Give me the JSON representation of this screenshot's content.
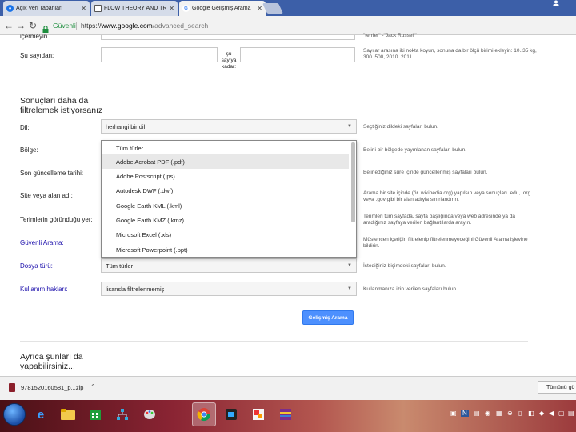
{
  "browser": {
    "tabs": [
      {
        "title": "Açık Veri Tabanları",
        "favicon": "#1a73e8",
        "active": false
      },
      {
        "title": "FLOW THEORY AND TRA",
        "favicon": "#7a5",
        "active": false
      },
      {
        "title": "Google Gelişmiş Arama",
        "favicon": "#fff",
        "favicon_letter": "G",
        "active": true
      }
    ],
    "secure_label": "Güvenli",
    "url_scheme": "https://",
    "url_host": "www.google.com",
    "url_path": "/advanced_search"
  },
  "form": {
    "top_cut_label": "içermeyin",
    "top_cut_hint": "\"terrier\" -\"Jack Russell\"",
    "range": {
      "label": "Şu sayıdan:",
      "to_label": "şu\nsayıya\nkadar:",
      "hint": "Sayılar arasına iki nokta koyun, sonuna da bir ölçü birimi ekleyin: 10..35 kg, 300..500, 2010..2011"
    },
    "section_title": "Sonuçları daha da\nfiltrelemek istiyorsanız",
    "rows": [
      {
        "label": "Dil:",
        "link": false,
        "select": "herhangi bir dil",
        "hint": "Seçtiğiniz dildeki sayfaları bulun."
      },
      {
        "label": "Bölge:",
        "link": false,
        "select": "",
        "hint": "Belirli bir bölgede yayınlanan sayfaları bulun."
      },
      {
        "label": "Son güncelleme tarihi:",
        "link": false,
        "select": "",
        "hint": "Belirlediğiniz süre içinde güncellenmiş sayfaları bulun."
      },
      {
        "label": "Site veya alan adı:",
        "link": false,
        "select": "",
        "hint": "Arama bir site içinde (ör. wikipedia.org) yapılsın veya sonuçları .edu, .org veya .gov gibi bir alan adıyla sınırlandırın."
      },
      {
        "label": "Terimlerin göründuğu yer:",
        "link": false,
        "select": "",
        "hint": "Terimleri tüm sayfada, sayfa başlığında veya web adresinde ya da aradığınız sayfaya verilen bağlantılarda arayın."
      },
      {
        "label": "Güvenli Arama:",
        "link": true,
        "select": "",
        "hint": "Müstehcen içeriğin filtrelenip filtrelenmeyeceğini Güvenli Arama işlevine bildirin."
      },
      {
        "label": "Dosya türü:",
        "link": true,
        "select": "Tüm türler",
        "hint": "İstediğiniz biçimdeki sayfaları bulun."
      },
      {
        "label": "Kullanım hakları:",
        "link": true,
        "select": "lisansla filtrelenmemiş",
        "hint": "Kullanmanıza izin verilen sayfaları bulun."
      }
    ],
    "dropdown_options": [
      "Tüm türler",
      "Adobe Acrobat PDF (.pdf)",
      "Adobe Postscript (.ps)",
      "Autodesk DWF (.dwf)",
      "Google Earth KML (.kml)",
      "Google Earth KMZ (.kmz)",
      "Microsoft Excel (.xls)",
      "Microsoft Powerpoint (.ppt)"
    ],
    "dropdown_highlight_index": 1,
    "submit_label": "Gelişmiş Arama",
    "bottom_section_title": "Ayrıca şunları da\nyapabilirsiniz..."
  },
  "download": {
    "file_name": "9781520160581_p...zip",
    "show_all_label": "Tümünü gö"
  },
  "taskbar": {
    "apps": [
      "explorer",
      "internet-explorer",
      "file-explorer",
      "store",
      "network",
      "paint",
      "chrome",
      "app-dark",
      "paint-app",
      "winrar"
    ],
    "active_index": 6
  }
}
